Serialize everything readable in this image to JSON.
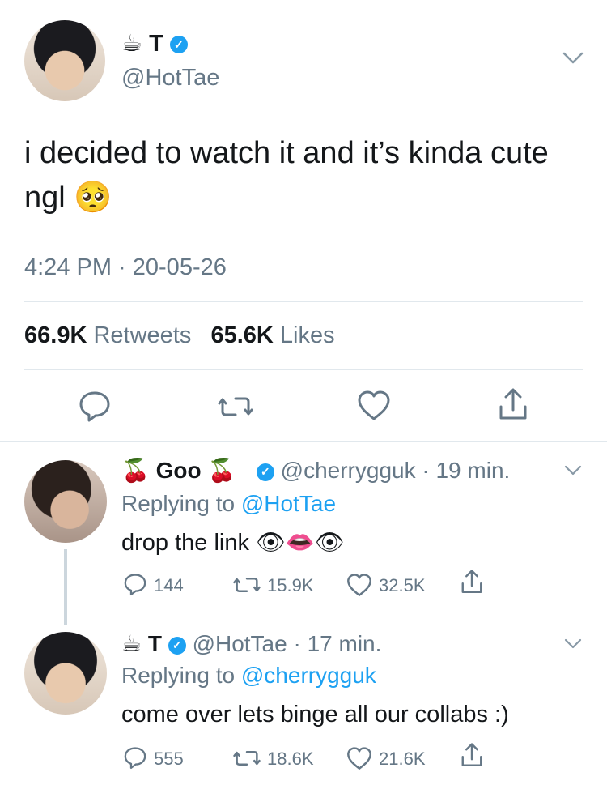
{
  "main": {
    "emoji": "☕",
    "name": "T",
    "handle": "@HotTae",
    "text1": "i decided to watch it and it’s kinda cute",
    "text2": "ngl",
    "text_emoji": "🥺",
    "time": "4:24 PM · 20-05-26",
    "retweets_count": "66.9K",
    "retweets_label": "Retweets",
    "likes_count": "65.6K",
    "likes_label": "Likes"
  },
  "reply1": {
    "emoji_left": "🍒",
    "name": "Goo",
    "emoji_right": "🍒",
    "handle": "@cherrygguk",
    "time": "· 19 min.",
    "replying_prefix": "Replying to",
    "replying_to": "@HotTae",
    "text": "drop the link",
    "text_emojis": "👁👄👁",
    "replies": "144",
    "retweets": "15.9K",
    "likes": "32.5K"
  },
  "reply2": {
    "emoji": "☕",
    "name": "T",
    "handle": "@HotTae",
    "time": "· 17 min.",
    "replying_prefix": "Replying to",
    "replying_to": "@cherrygguk",
    "text": "come over lets binge all our collabs :)",
    "replies": "555",
    "retweets": "18.6K",
    "likes": "21.6K"
  },
  "colors": {
    "accent": "#1da1f2",
    "secondary_text": "#657786",
    "divider": "#e1e8ed"
  }
}
